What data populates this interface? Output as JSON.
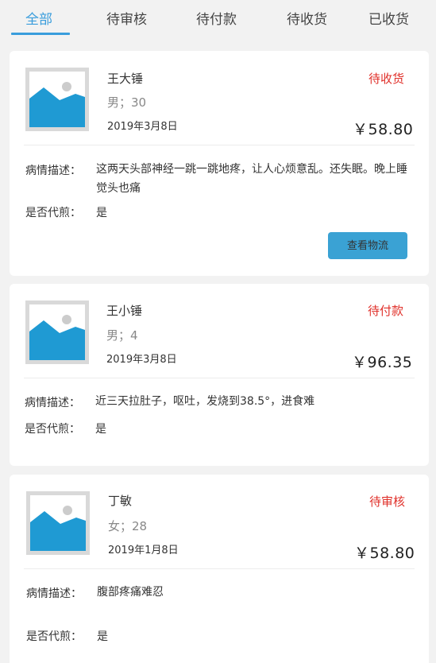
{
  "tabs": [
    {
      "label": "全部",
      "active": true
    },
    {
      "label": "待审核",
      "active": false
    },
    {
      "label": "待付款",
      "active": false
    },
    {
      "label": "待收货",
      "active": false
    },
    {
      "label": "已收货",
      "active": false
    }
  ],
  "colors": {
    "accent": "#3a9ddc",
    "status": "#e0302a",
    "button": "#3aa2d4",
    "background": "#f2f2f2"
  },
  "labels": {
    "description": "病情描述：",
    "decoction": "是否代煎："
  },
  "orders": [
    {
      "name": "王大锤",
      "gender_age": "男；30",
      "date": "2019年3月8日",
      "status": "待收货",
      "price": "￥58.80",
      "description": "这两天头部神经一跳一跳地疼，让人心烦意乱。还失眠。晚上睡觉头也痛",
      "decoction": "是",
      "button_label": "查看物流",
      "thumbnail_icon": "image-placeholder-icon"
    },
    {
      "name": "王小锤",
      "gender_age": "男；4",
      "date": "2019年3月8日",
      "status": "待付款",
      "price": "￥96.35",
      "description": "近三天拉肚子，呕吐，发烧到38.5°，进食难",
      "decoction": "是",
      "thumbnail_icon": "image-placeholder-icon"
    },
    {
      "name": "丁敏",
      "gender_age": "女；28",
      "date": "2019年1月8日",
      "status": "待审核",
      "price": "￥58.80",
      "description": "腹部疼痛难忍",
      "decoction": "是",
      "thumbnail_icon": "image-placeholder-icon"
    }
  ]
}
